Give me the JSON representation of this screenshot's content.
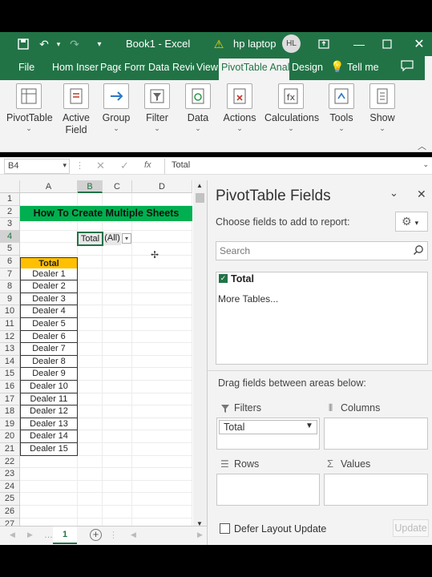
{
  "title_bar": {
    "doc_title": "Book1  -  Excel",
    "warning_text": "hp laptop",
    "user_initials": "HL"
  },
  "tabs": [
    "File",
    "Hom",
    "Inser",
    "Page",
    "Form",
    "Data",
    "Revie",
    "View",
    "PivotTable Analy",
    "Design",
    "Tell me"
  ],
  "ribbon": [
    {
      "label": "PivotTable",
      "icon": "pivottable-icon"
    },
    {
      "label": "Active Field",
      "icon": "active-field-icon"
    },
    {
      "label": "Group",
      "icon": "group-icon"
    },
    {
      "label": "Filter",
      "icon": "filter-icon"
    },
    {
      "label": "Data",
      "icon": "data-icon"
    },
    {
      "label": "Actions",
      "icon": "actions-icon"
    },
    {
      "label": "Calculations",
      "icon": "calculations-icon"
    },
    {
      "label": "Tools",
      "icon": "tools-icon"
    },
    {
      "label": "Show",
      "icon": "show-icon"
    }
  ],
  "formula_bar": {
    "name_box": "B4",
    "fx": "fx",
    "content": "Total"
  },
  "grid": {
    "columns": [
      "A",
      "B",
      "C",
      "D"
    ],
    "rows": [
      "1",
      "2",
      "3",
      "4",
      "5",
      "6",
      "7",
      "8",
      "9",
      "10",
      "11",
      "12",
      "13",
      "14",
      "15",
      "16",
      "17",
      "18",
      "19",
      "20",
      "21",
      "22",
      "23",
      "24",
      "25",
      "26",
      "27"
    ],
    "title": "How To Create Multiple Sheets",
    "filter_label": "Total",
    "filter_value": "(All)",
    "header": "Total",
    "dealers": [
      "Dealer 1",
      "Dealer 2",
      "Dealer 3",
      "Dealer 4",
      "Dealer 5",
      "Dealer 6",
      "Dealer 7",
      "Dealer 8",
      "Dealer 9",
      "Dealer 10",
      "Dealer 11",
      "Dealer 12",
      "Dealer 13",
      "Dealer 14",
      "Dealer 15"
    ]
  },
  "sheet_tab": "1",
  "pane": {
    "title": "PivotTable Fields",
    "subtitle": "Choose fields to add to report:",
    "search_placeholder": "Search",
    "field": "Total",
    "more_tables": "More Tables...",
    "drag_text": "Drag fields between areas below:",
    "filters_label": "Filters",
    "columns_label": "Columns",
    "rows_label": "Rows",
    "values_label": "Values",
    "filter_item": "Total",
    "defer_label": "Defer Layout Update",
    "update_button": "Update"
  },
  "colors": {
    "excel_green": "#217346",
    "title_green": "#00b050",
    "header_orange": "#ffc000"
  }
}
